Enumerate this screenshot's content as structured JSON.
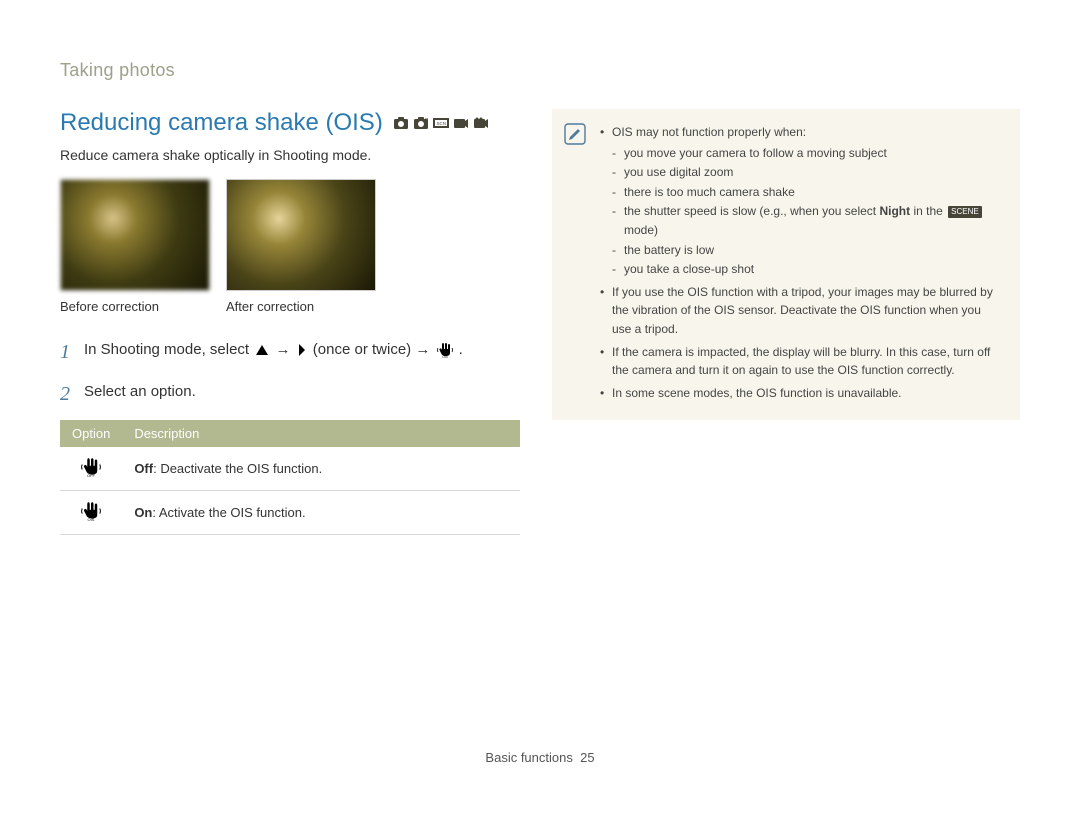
{
  "breadcrumb": "Taking photos",
  "heading": "Reducing camera shake (OIS)",
  "subhead": "Reduce camera shake optically in Shooting mode.",
  "captions": {
    "before": "Before correction",
    "after": "After correction"
  },
  "steps": {
    "s1_a": "In Shooting mode, select ",
    "s1_b": " → ",
    "s1_c": " (once or twice) → ",
    "s1_d": ".",
    "s2": "Select an option."
  },
  "tableHeaders": {
    "option": "Option",
    "description": "Description"
  },
  "options": {
    "offBold": "Off",
    "offRest": ": Deactivate the OIS function.",
    "onBold": "On",
    "onRest": ": Activate the OIS function."
  },
  "notes": {
    "intro": "OIS may not function properly when:",
    "n1": "you move your camera to follow a moving subject",
    "n2": "you use digital zoom",
    "n3": "there is too much camera shake",
    "n4a": "the shutter speed is slow (e.g., when you select ",
    "n4bold": "Night",
    "n4b": " in the ",
    "n4c": " mode)",
    "sceneBadge": "SCENE",
    "n5": "the battery is low",
    "n6": "you take a close-up shot",
    "b2": "If you use the OIS function with a tripod, your images may be blurred by the vibration of the OIS sensor. Deactivate the OIS function when you use a tripod.",
    "b3": "If the camera is impacted, the display will be blurry. In this case, turn off the camera and turn it on again to use the OIS function correctly.",
    "b4": "In some scene modes, the OIS function is unavailable."
  },
  "footer": {
    "section": "Basic functions",
    "page": "25"
  }
}
